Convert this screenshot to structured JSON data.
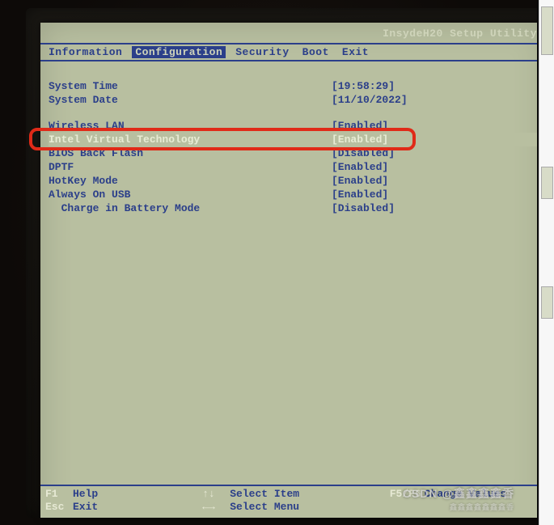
{
  "title": "InsydeH20 Setup Utility",
  "tabs": {
    "information": "Information",
    "configuration": "Configuration",
    "security": "Security",
    "boot": "Boot",
    "exit": "Exit"
  },
  "rows": [
    {
      "label": "System Time",
      "value": "[19:58:29]"
    },
    {
      "label": "System Date",
      "value": "[11/10/2022]"
    },
    {
      "label": "",
      "value": ""
    },
    {
      "label": "Wireless LAN",
      "value": "[Enabled]"
    },
    {
      "label": "Intel Virtual Technology",
      "value": "[Enabled]"
    },
    {
      "label": "BIOS Back Flash",
      "value": "[Disabled]"
    },
    {
      "label": "DPTF",
      "value": "[Enabled]"
    },
    {
      "label": "HotKey Mode",
      "value": "[Enabled]"
    },
    {
      "label": "Always On USB",
      "value": "[Enabled]"
    },
    {
      "label": "  Charge in Battery Mode",
      "value": "[Disabled]"
    }
  ],
  "footer": {
    "f1_key": "F1",
    "f1_txt": "Help",
    "arrows1_key": "↑↓",
    "arrows1_txt": "Select Item",
    "f5f6_key": "F5/F6",
    "f5f6_txt": "Change Values",
    "esc_key": "Esc",
    "esc_txt": "Exit",
    "arrows2_key": "←→",
    "arrows2_txt": "Select Menu"
  },
  "watermark": {
    "main": "CSDN @鑫鑫鑫鑫香",
    "sub": "鑫鑫鑫鑫鑫鑫鑫香"
  }
}
